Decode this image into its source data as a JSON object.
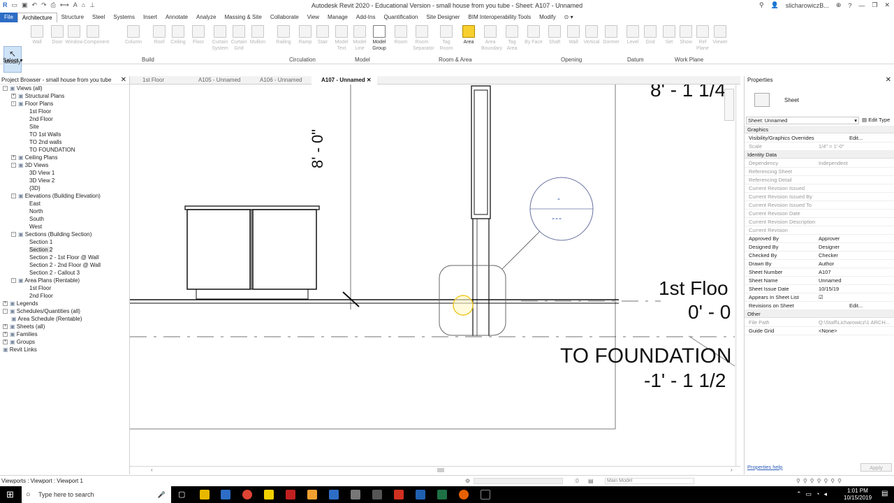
{
  "window": {
    "title": "Autodesk Revit 2020 - Educational Version - small house from you tube - Sheet: A107 - Unnamed",
    "user": "slicharowiczB..."
  },
  "menu": {
    "tabs": [
      "File",
      "Architecture",
      "Structure",
      "Steel",
      "Systems",
      "Insert",
      "Annotate",
      "Analyze",
      "Massing & Site",
      "Collaborate",
      "View",
      "Manage",
      "Add-Ins",
      "Quantification",
      "Site Designer",
      "BIM Interoperability Tools",
      "Modify"
    ],
    "active": "Architecture"
  },
  "ribbon": {
    "modify_label": "Modify",
    "select_label": "Select",
    "buttons": [
      {
        "label": "Wall",
        "on": false
      },
      {
        "label": "Door",
        "on": false
      },
      {
        "label": "Window",
        "on": false
      },
      {
        "label": "Component",
        "on": false
      },
      {
        "label": "Column",
        "on": false
      },
      {
        "label": "Roof",
        "on": false
      },
      {
        "label": "Ceiling",
        "on": false
      },
      {
        "label": "Floor",
        "on": false
      },
      {
        "label": "Curtain System",
        "on": false
      },
      {
        "label": "Curtain Grid",
        "on": false
      },
      {
        "label": "Mullion",
        "on": false
      },
      {
        "label": "Railing",
        "on": false
      },
      {
        "label": "Ramp",
        "on": false
      },
      {
        "label": "Stair",
        "on": false
      },
      {
        "label": "Model Text",
        "on": false
      },
      {
        "label": "Model Line",
        "on": false
      },
      {
        "label": "Model Group",
        "on": true
      },
      {
        "label": "Room",
        "on": false
      },
      {
        "label": "Room Separator",
        "on": false
      },
      {
        "label": "Tag Room",
        "on": false
      },
      {
        "label": "Area",
        "on": true
      },
      {
        "label": "Area Boundary",
        "on": false
      },
      {
        "label": "Tag Area",
        "on": false
      },
      {
        "label": "By Face",
        "on": false
      },
      {
        "label": "Shaft",
        "on": false
      },
      {
        "label": "Wall",
        "on": false
      },
      {
        "label": "Vertical",
        "on": false
      },
      {
        "label": "Dormer",
        "on": false
      },
      {
        "label": "Level",
        "on": false
      },
      {
        "label": "Grid",
        "on": false
      },
      {
        "label": "Set",
        "on": false
      },
      {
        "label": "Show",
        "on": false
      },
      {
        "label": "Ref Plane",
        "on": false
      },
      {
        "label": "Viewer",
        "on": false
      }
    ],
    "panels": [
      "Build",
      "Circulation",
      "Model",
      "Room & Area",
      "Opening",
      "Datum",
      "Work Plane"
    ]
  },
  "project_browser": {
    "title": "Project Browser - small house from you tube",
    "items": [
      {
        "label": "Views (all)",
        "level": 0,
        "exp": "-"
      },
      {
        "label": "Structural Plans",
        "level": 1,
        "exp": "+"
      },
      {
        "label": "Floor Plans",
        "level": 1,
        "exp": "-"
      },
      {
        "label": "1st Floor",
        "level": 2,
        "exp": ""
      },
      {
        "label": "2nd Floor",
        "level": 2,
        "exp": ""
      },
      {
        "label": "Site",
        "level": 2,
        "exp": ""
      },
      {
        "label": "TO 1st Walls",
        "level": 2,
        "exp": ""
      },
      {
        "label": "TO 2nd walls",
        "level": 2,
        "exp": ""
      },
      {
        "label": "TO FOUNDATION",
        "level": 2,
        "exp": ""
      },
      {
        "label": "Ceiling Plans",
        "level": 1,
        "exp": "+"
      },
      {
        "label": "3D Views",
        "level": 1,
        "exp": "-"
      },
      {
        "label": "3D View 1",
        "level": 2,
        "exp": ""
      },
      {
        "label": "3D View 2",
        "level": 2,
        "exp": ""
      },
      {
        "label": "{3D}",
        "level": 2,
        "exp": ""
      },
      {
        "label": "Elevations (Building Elevation)",
        "level": 1,
        "exp": "-"
      },
      {
        "label": "East",
        "level": 2,
        "exp": ""
      },
      {
        "label": "North",
        "level": 2,
        "exp": ""
      },
      {
        "label": "South",
        "level": 2,
        "exp": ""
      },
      {
        "label": "West",
        "level": 2,
        "exp": ""
      },
      {
        "label": "Sections (Building Section)",
        "level": 1,
        "exp": "-"
      },
      {
        "label": "Section 1",
        "level": 2,
        "exp": ""
      },
      {
        "label": "Section 2",
        "level": 2,
        "exp": "",
        "selected": true
      },
      {
        "label": "Section 2 - 1st Floor @ Wall",
        "level": 2,
        "exp": ""
      },
      {
        "label": "Section 2 - 2nd Floor @ Wall",
        "level": 2,
        "exp": ""
      },
      {
        "label": "Section 2 - Callout 3",
        "level": 2,
        "exp": ""
      },
      {
        "label": "Area Plans (Rentable)",
        "level": 1,
        "exp": "-"
      },
      {
        "label": "1st Floor",
        "level": 2,
        "exp": ""
      },
      {
        "label": "2nd Floor",
        "level": 2,
        "exp": ""
      },
      {
        "label": "Legends",
        "level": 0,
        "exp": "+"
      },
      {
        "label": "Schedules/Quantities (all)",
        "level": 0,
        "exp": "-"
      },
      {
        "label": "Area Schedule (Rentable)",
        "level": 1,
        "exp": ""
      },
      {
        "label": "Sheets (all)",
        "level": 0,
        "exp": "+"
      },
      {
        "label": "Families",
        "level": 0,
        "exp": "+"
      },
      {
        "label": "Groups",
        "level": 0,
        "exp": "+"
      },
      {
        "label": "Revit Links",
        "level": 0,
        "exp": ""
      }
    ]
  },
  "view_tabs": [
    "1st Floor",
    "A105 - Unnamed",
    "A106 - Unnamed",
    "A107 - Unnamed"
  ],
  "canvas": {
    "dim_vertical": "8' - 0\"",
    "level_top": "8' - 1 1/4",
    "level_1_name": "1st Floo",
    "level_1_value": "0' - 0",
    "level_fdn_name": "TO FOUNDATION",
    "level_fdn_value": "-1' - 1 1/2",
    "callout_top": "-",
    "callout_bottom": "---"
  },
  "properties": {
    "title": "Properties",
    "family": "Sheet",
    "type_selector": "Sheet: Unnamed",
    "edit_type_label": "Edit Type",
    "sections": {
      "graphics": "Graphics",
      "identity": "Identity Data",
      "other": "Other"
    },
    "graphics_rows": [
      {
        "k": "Visibility/Graphics Overrides",
        "v": "Edit...",
        "dim": false
      },
      {
        "k": "Scale",
        "v": "1/4\" = 1'-0\"",
        "dim": true
      }
    ],
    "identity_rows": [
      {
        "k": "Dependency",
        "v": "Independent",
        "dim": true
      },
      {
        "k": "Referencing Sheet",
        "v": "",
        "dim": true
      },
      {
        "k": "Referencing Detail",
        "v": "",
        "dim": true
      },
      {
        "k": "Current Revision Issued",
        "v": "",
        "dim": true
      },
      {
        "k": "Current Revision Issued By",
        "v": "",
        "dim": true
      },
      {
        "k": "Current Revision Issued To",
        "v": "",
        "dim": true
      },
      {
        "k": "Current Revision Date",
        "v": "",
        "dim": true
      },
      {
        "k": "Current Revision Description",
        "v": "",
        "dim": true
      },
      {
        "k": "Current Revision",
        "v": "",
        "dim": true
      },
      {
        "k": "Approved By",
        "v": "Approver",
        "dim": false
      },
      {
        "k": "Designed By",
        "v": "Designer",
        "dim": false
      },
      {
        "k": "Checked By",
        "v": "Checker",
        "dim": false
      },
      {
        "k": "Drawn By",
        "v": "Author",
        "dim": false
      },
      {
        "k": "Sheet Number",
        "v": "A107",
        "dim": false
      },
      {
        "k": "Sheet Name",
        "v": "Unnamed",
        "dim": false
      },
      {
        "k": "Sheet Issue Date",
        "v": "10/15/19",
        "dim": false
      },
      {
        "k": "Appears In Sheet List",
        "v": "☑",
        "dim": false
      },
      {
        "k": "Revisions on Sheet",
        "v": "Edit...",
        "dim": false
      }
    ],
    "other_rows": [
      {
        "k": "File Path",
        "v": "Q:\\Staff\\Licharowicz\\1 ARCH...",
        "dim": true
      },
      {
        "k": "Guide Grid",
        "v": "<None>",
        "dim": false
      }
    ],
    "help_link": "Properties help",
    "apply_label": "Apply"
  },
  "status": {
    "left": "Viewports : Viewport : Viewport 1",
    "model": "Main Model",
    "zero": ":0"
  },
  "taskbar": {
    "search_placeholder": "Type here to search",
    "time": "1:01 PM",
    "date": "10/15/2019"
  }
}
